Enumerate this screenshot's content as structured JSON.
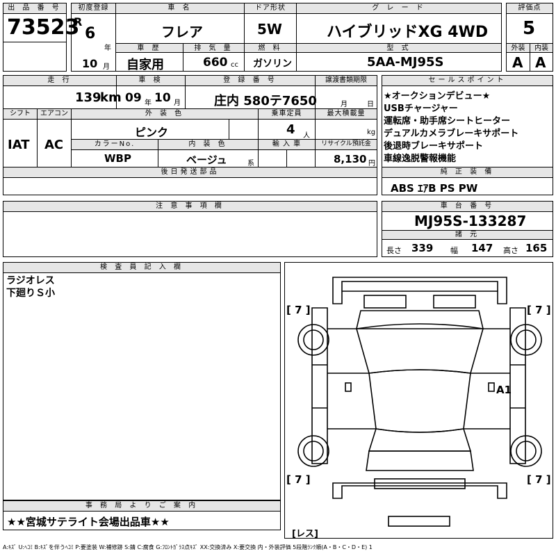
{
  "lot": {
    "label": "出 品 番 号",
    "value": "73523"
  },
  "first_reg": {
    "label": "初度登録",
    "era": "R",
    "year": "6",
    "year_unit": "年",
    "month": "10",
    "month_unit": "月"
  },
  "car_name": {
    "label": "車 名",
    "value": "フレア"
  },
  "door": {
    "label": "ドア形状",
    "value": "5W"
  },
  "grade": {
    "label": "グ レ ー ド",
    "value": "ハイブリッドXG 4WD"
  },
  "score": {
    "label": "評価点",
    "value": "5"
  },
  "history": {
    "label": "車 歴",
    "value": "自家用"
  },
  "displacement": {
    "label": "排 気 量",
    "value": "660",
    "unit": "cc"
  },
  "fuel": {
    "label": "燃 料",
    "value": "ガソリン"
  },
  "model": {
    "label": "型 式",
    "value": "5AA-MJ95S"
  },
  "exterior": {
    "label": "外装",
    "value": "A"
  },
  "interior": {
    "label": "内装",
    "value": "A"
  },
  "mileage": {
    "label": "走 行",
    "value": "139",
    "unit": "km"
  },
  "inspection": {
    "label": "車 検",
    "year": "09",
    "year_unit": "年",
    "month": "10",
    "month_unit": "月"
  },
  "plate": {
    "label": "登 録 番 号",
    "value": "庄内 580テ7650"
  },
  "transfer": {
    "label": "譲渡書類期限",
    "month_unit": "月",
    "day_unit": "日"
  },
  "shift": {
    "label": "シフト",
    "value": "IAT"
  },
  "aircon": {
    "label": "エアコン",
    "value": "AC"
  },
  "color": {
    "label": "外 装 色",
    "value": "ピンク"
  },
  "capacity": {
    "label": "乗車定員",
    "value": "4",
    "unit": "人"
  },
  "load": {
    "label": "最大積載量",
    "unit": "kg"
  },
  "color_no": {
    "label": "カラーNo.",
    "value": "WBP"
  },
  "int_color": {
    "label": "内 装 色",
    "value": "ベージュ",
    "unit": "系"
  },
  "import": {
    "label": "輸 入 車"
  },
  "recycle": {
    "label": "リサイクル預託金",
    "value": "8,130",
    "unit": "円"
  },
  "sales_points": {
    "label": "セールスポイント",
    "lines": [
      "★オークションデビュー★",
      "USBチャージャー",
      "運転席・助手席シートヒーター",
      "デュアルカメラブレーキサポート",
      "後退時ブレーキサポート",
      "車線逸脱警報機能"
    ]
  },
  "later_parts": {
    "label": "後日発送部品"
  },
  "equipment": {
    "label": "純 正 装 備",
    "value": "ABS ｴｱB PS PW"
  },
  "caution": {
    "label": "注 意 事 項 欄"
  },
  "chassis": {
    "label": "車 台 番 号",
    "value": "MJ95S-133287"
  },
  "dims": {
    "label": "諸 元",
    "length_label": "長さ",
    "length": "339",
    "width_label": "幅",
    "width": "147",
    "height_label": "高さ",
    "height": "165"
  },
  "inspector": {
    "label": "検 査 員 記 入 欄",
    "lines": [
      "ラジオレス",
      "下廻りＳ小"
    ]
  },
  "office": {
    "label": "事 務 局 よ り ご 案 内",
    "value": "★★宮城サテライト会場出品車★★"
  },
  "diagram": {
    "tire_fl": "[ 7 ]",
    "tire_fr": "[ 7 ]",
    "tire_rl": "[ 7 ]",
    "tire_rr": "[ 7 ]",
    "damage": "A1",
    "less": "[レス]"
  },
  "legend": "A:ｷｽﾞ U:ﾍｺﾐ B:ｷｽﾞを伴うﾍｺﾐ P:要塗装 W:補修跡 S:錆 C:腐食 G:ﾌﾛﾝﾄｶﾞﾗｽ点ｷｽﾞ XX:交換済み X:要交換 内・外装評価 5段階ﾗﾝｸ順(A・B・C・D・E) 1"
}
